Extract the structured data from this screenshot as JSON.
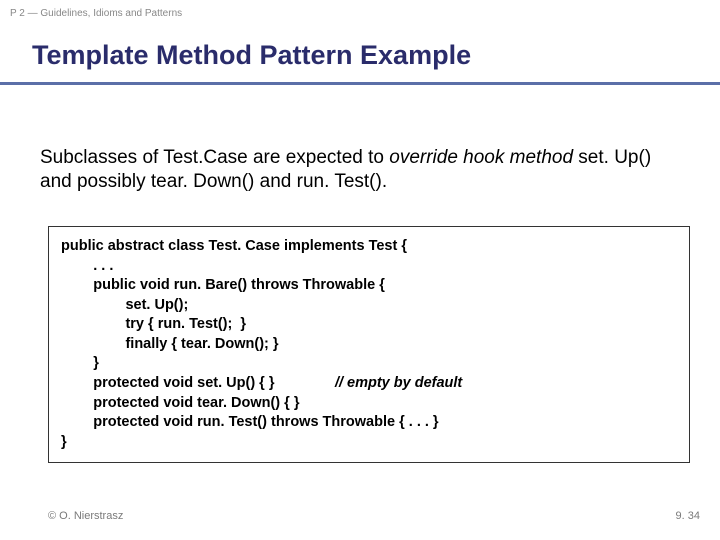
{
  "header": "P 2 — Guidelines, Idioms and Patterns",
  "title": "Template Method Pattern Example",
  "description": {
    "part1": "Subclasses of Test.Case are expected to ",
    "italic": "override hook method",
    "part2": " set. Up() and possibly tear. Down() and run. Test()."
  },
  "code": {
    "l1": "public abstract class Test. Case implements Test {",
    "l2": "        . . .",
    "l3": "        public void run. Bare() throws Throwable {",
    "l4": "                set. Up();",
    "l5": "                try { run. Test();  }",
    "l6": "                finally { tear. Down(); }",
    "l7": "        }",
    "l8a": "        protected void set. Up() { }               ",
    "l8b": "// empty by default",
    "l9": "        protected void tear. Down() { }",
    "l10": "        protected void run. Test() throws Throwable { . . . }",
    "l11": "}"
  },
  "footer": {
    "left": "© O. Nierstrasz",
    "right": "9. 34"
  }
}
